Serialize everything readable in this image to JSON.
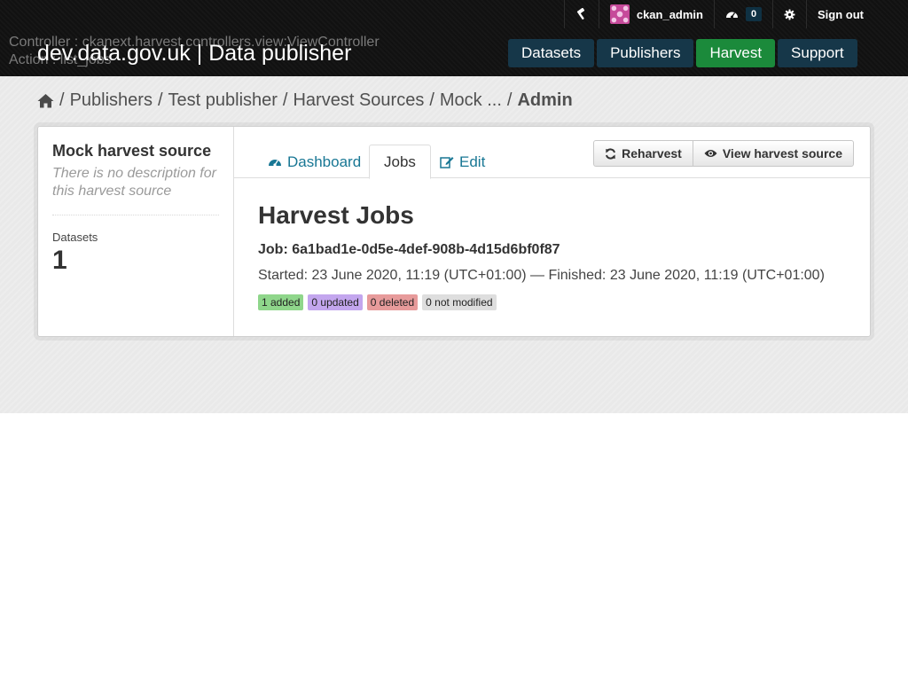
{
  "debug": {
    "controller": "Controller : ckanext.harvest.controllers.view:ViewController",
    "action": "Action : list_jobs"
  },
  "site": {
    "title": "dev.data.gov.uk | Data publisher"
  },
  "account": {
    "admin_icon": "hammer-icon",
    "username": "ckan_admin",
    "dashboard_icon": "dashboard-icon",
    "dashboard_count": "0",
    "settings_icon": "gear-icon",
    "signout_label": "Sign out"
  },
  "nav": {
    "items": [
      {
        "label": "Datasets"
      },
      {
        "label": "Publishers"
      },
      {
        "label": "Harvest"
      },
      {
        "label": "Support"
      }
    ],
    "active": "Harvest",
    "colors": {
      "default": "#163749",
      "active": "#1b8a3b"
    }
  },
  "breadcrumb": {
    "home_icon": "home-icon",
    "sep": "/",
    "items": [
      "Publishers",
      "Test publisher",
      "Harvest Sources",
      "Mock ..."
    ],
    "current": "Admin"
  },
  "sidebar": {
    "title": "Mock harvest source",
    "description": "There is no description for this harvest source",
    "stat_label": "Datasets",
    "stat_value": "1"
  },
  "tabs": {
    "dashboard": "Dashboard",
    "jobs": "Jobs",
    "edit": "Edit",
    "active": "Jobs"
  },
  "actions": {
    "reharvest": "Reharvest",
    "view_source": "View harvest source"
  },
  "main": {
    "heading": "Harvest Jobs",
    "job_title": "Job: 6a1bad1e-0d5e-4def-908b-4d15d6bf0f87",
    "times": "Started: 23 June 2020, 11:19 (UTC+01:00) — Finished: 23 June 2020, 11:19 (UTC+01:00)",
    "labels": [
      {
        "text": "1 added",
        "color": "#8fd68b"
      },
      {
        "text": "0 updated",
        "color": "#c3a6ee"
      },
      {
        "text": "0 deleted",
        "color": "#e79b9b"
      },
      {
        "text": "0 not modified",
        "color": "#dedede"
      }
    ]
  }
}
